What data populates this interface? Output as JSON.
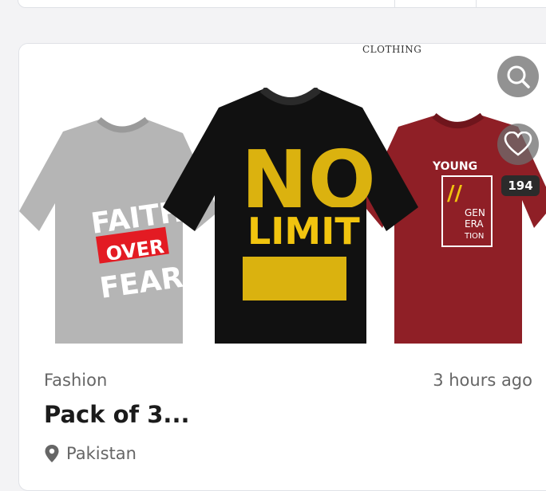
{
  "listing": {
    "brand_text": "CLOTHING",
    "image_alt": "Pack of three printed t-shirts",
    "shirts": [
      {
        "lines": [
          "FAITH",
          "OVER",
          "FEAR"
        ]
      },
      {
        "lines": [
          "NO",
          "LIMIT"
        ]
      },
      {
        "lines": [
          "YOUNG",
          "GEN",
          "ERA",
          "TION"
        ]
      }
    ],
    "favorite_count": "194",
    "category": "Fashion",
    "time_ago": "3 hours ago",
    "title": "Pack of 3...",
    "location": "Pakistan"
  },
  "icons": {
    "search": "search-icon",
    "favorite": "heart-icon",
    "location": "location-pin-icon"
  },
  "colors": {
    "shirt_grey": "#b5b5b5",
    "shirt_black": "#111111",
    "shirt_red": "#8f1f26",
    "accent_red": "#e31b23",
    "accent_yellow": "#f1c40f",
    "text_dark": "#1b1b1b",
    "text_muted": "#666666"
  }
}
